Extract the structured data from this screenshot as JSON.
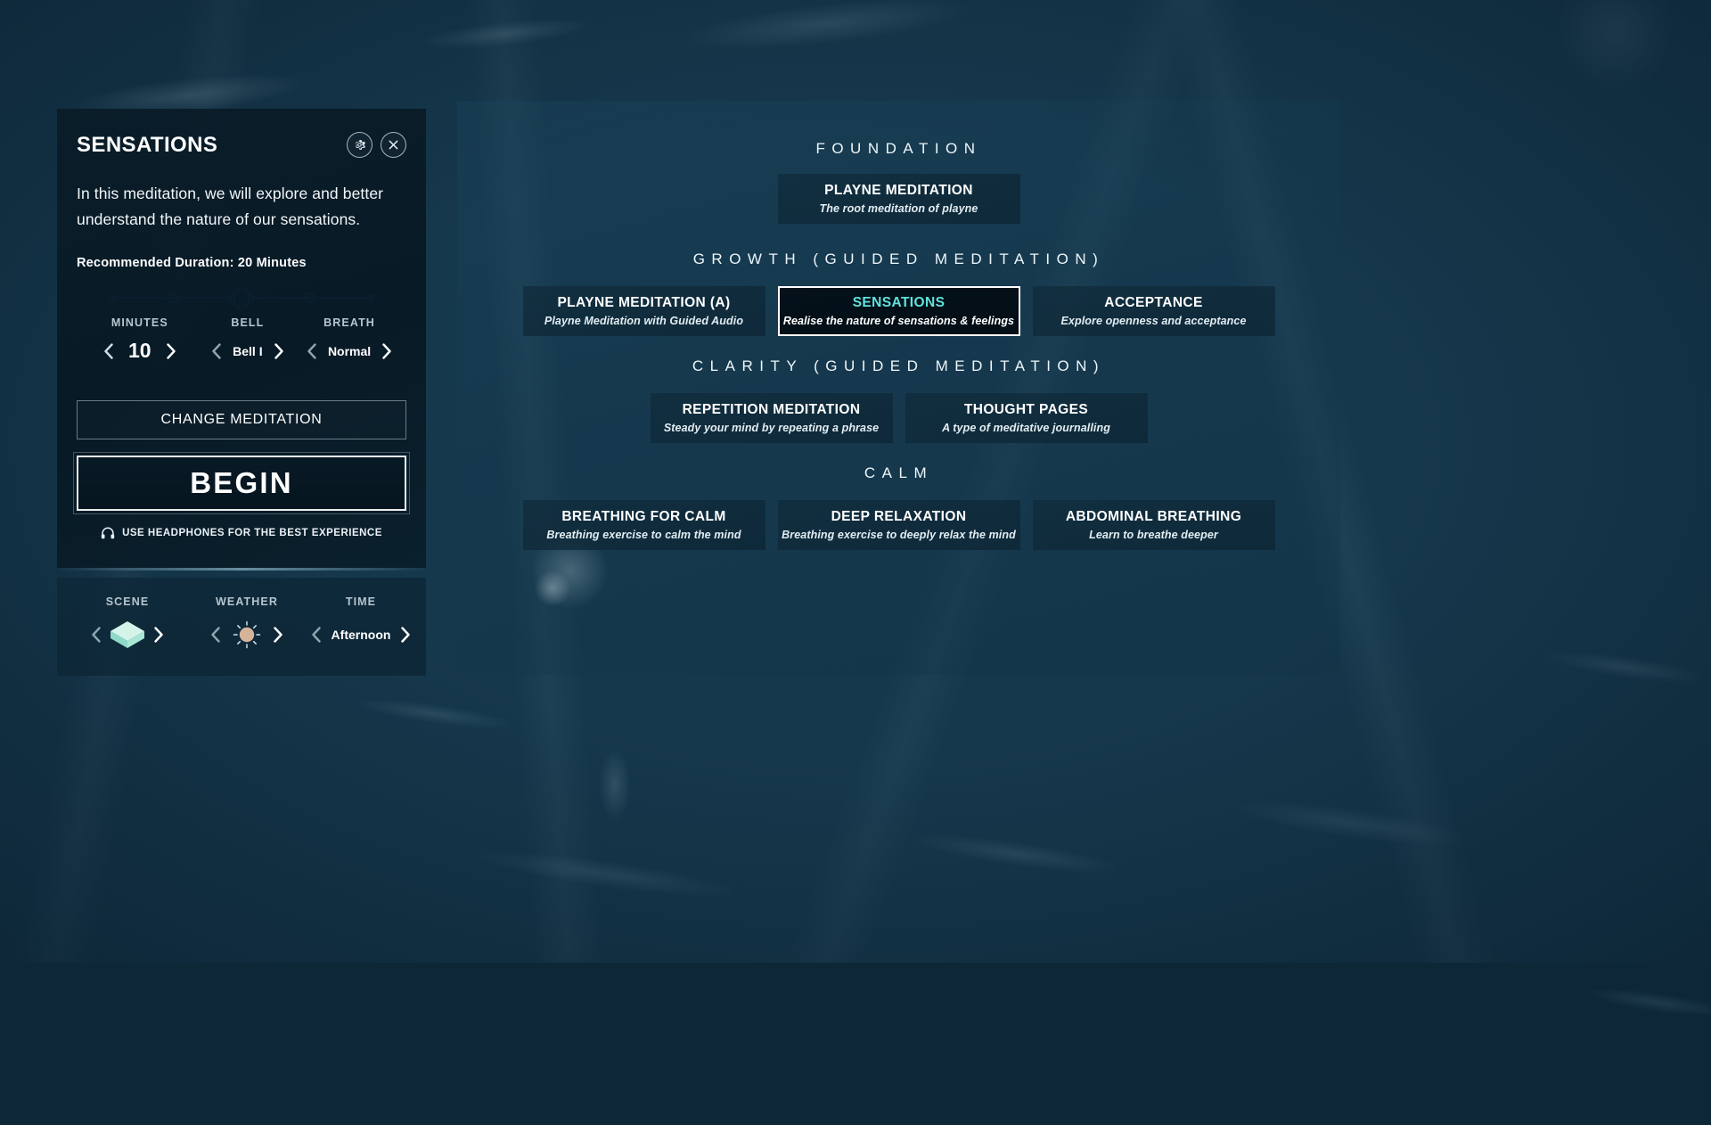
{
  "detail": {
    "title": "SENSATIONS",
    "description": "In this meditation, we will explore and better understand the nature of our sensations.",
    "recommended_duration": "Recommended Duration: 20 Minutes",
    "settings_icon": "gear-icon",
    "close_icon": "close-icon",
    "steppers": [
      {
        "label": "MINUTES",
        "value": "10"
      },
      {
        "label": "BELL",
        "value": "Bell I"
      },
      {
        "label": "BREATH",
        "value": "Normal"
      }
    ],
    "change_button": "CHANGE MEDITATION",
    "begin_button": "BEGIN",
    "headphones_note": "USE HEADPHONES FOR THE BEST EXPERIENCE",
    "headphones_icon": "headphones-icon"
  },
  "environment": {
    "steppers": [
      {
        "label": "SCENE",
        "value": "",
        "icon": "cube-icon"
      },
      {
        "label": "WEATHER",
        "value": "",
        "icon": "sun-icon"
      },
      {
        "label": "TIME",
        "value": "Afternoon",
        "icon": ""
      }
    ]
  },
  "menu": {
    "sections": [
      {
        "heading": "FOUNDATION",
        "cards": [
          {
            "title": "PLAYNE MEDITATION",
            "subtitle": "The root meditation of playne",
            "selected": false
          }
        ]
      },
      {
        "heading": "GROWTH (GUIDED MEDITATION)",
        "cards": [
          {
            "title": "PLAYNE MEDITATION (A)",
            "subtitle": "Playne Meditation with Guided Audio",
            "selected": false
          },
          {
            "title": "SENSATIONS",
            "subtitle": "Realise the nature of sensations & feelings",
            "selected": true
          },
          {
            "title": "ACCEPTANCE",
            "subtitle": "Explore openness and acceptance",
            "selected": false
          }
        ]
      },
      {
        "heading": "CLARITY (GUIDED MEDITATION)",
        "cards": [
          {
            "title": "REPETITION MEDITATION",
            "subtitle": "Steady your mind by repeating a phrase",
            "selected": false
          },
          {
            "title": "THOUGHT PAGES",
            "subtitle": "A type of meditative journalling",
            "selected": false
          }
        ]
      },
      {
        "heading": "CALM",
        "cards": [
          {
            "title": "BREATHING FOR CALM",
            "subtitle": "Breathing exercise to calm the mind",
            "selected": false
          },
          {
            "title": "DEEP RELAXATION",
            "subtitle": "Breathing exercise to deeply relax the mind",
            "selected": false
          },
          {
            "title": "ABDOMINAL BREATHING",
            "subtitle": "Learn to breathe deeper",
            "selected": false
          }
        ]
      }
    ]
  },
  "colors": {
    "accent_cyan": "#5fe3dd",
    "cube_mint": "#a9ecdf",
    "sun_tan": "#d6b49b",
    "panel_dark": "#091c28"
  }
}
